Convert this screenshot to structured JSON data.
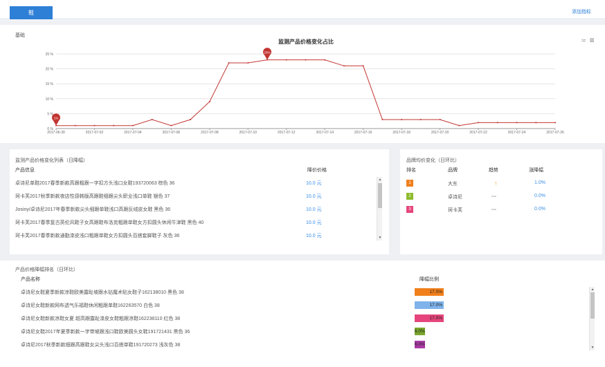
{
  "tab": {
    "label": "鞋"
  },
  "add_link": "添加指标",
  "chart_panel": {
    "label": "基础"
  },
  "chart_data": {
    "type": "line",
    "title": "监测产品价格变化占比",
    "x": [
      "2017-06-30",
      "2017-07-01",
      "2017-07-02",
      "2017-07-03",
      "2017-07-04",
      "2017-07-05",
      "2017-07-06",
      "2017-07-07",
      "2017-07-08",
      "2017-07-09",
      "2017-07-10",
      "2017-07-11",
      "2017-07-12",
      "2017-07-13",
      "2017-07-14",
      "2017-07-15",
      "2017-07-16",
      "2017-07-17",
      "2017-07-18",
      "2017-07-19",
      "2017-07-20",
      "2017-07-21",
      "2017-07-22",
      "2017-07-23",
      "2017-07-24",
      "2017-07-25",
      "2017-07-26"
    ],
    "xticks": [
      "2017-06-30",
      "2017-07-02",
      "2017-07-04",
      "2017-07-06",
      "2017-07-08",
      "2017-07-10",
      "2017-07-12",
      "2017-07-14",
      "2017-07-16",
      "2017-07-18",
      "2017-07-20",
      "2017-07-22",
      "2017-07-24",
      "2017-07-26"
    ],
    "values": [
      1,
      1,
      1,
      1,
      1,
      3,
      1,
      3,
      9,
      22,
      22,
      23,
      23,
      23,
      23,
      21,
      21,
      3,
      3,
      3,
      3,
      1,
      2,
      2,
      2,
      2,
      2
    ],
    "yticks": [
      "0 %",
      "5 %",
      "10 %",
      "15 %",
      "20 %",
      "25 %"
    ],
    "ylim": [
      0,
      25
    ],
    "markers": [
      {
        "index": 0,
        "label": "1%"
      },
      {
        "index": 11,
        "label": "23%"
      }
    ],
    "grid": true,
    "line_color": "#c23531"
  },
  "price_list": {
    "title": "监测产品价格变化列表（日降幅）",
    "col_product": "产品信息",
    "col_price": "降价价格",
    "rows": [
      {
        "name": "卓诗尼单鞋2017春季新款高跟粗跟一字扣方头浅口女鞋193720063 棕色 36",
        "price": "10.0 元"
      },
      {
        "name": "珂卡芙2017秋季新款夜店性感韩版高跟鞋细跟尖头职业浅口单鞋 银色 37",
        "price": "10.0 元"
      },
      {
        "name": "Josiny/卓诗尼2017年春季新款尖头细跟单鞋浅口高跟反绒皮女鞋 黑色 36",
        "price": "10.0 元"
      },
      {
        "name": "珂卡芙2017春季复古英伦风鞋子女高跟鞋布洛克粗跟单鞋女方扣圆头休闲牛津鞋 黑色 40",
        "price": "10.0 元"
      },
      {
        "name": "珂卡芙2017春季新款通勤漆皮浅口粗跟单鞋女方扣圆头百搭套脚鞋子 灰色 36",
        "price": "10.0 元"
      }
    ]
  },
  "brand_panel": {
    "title": "品牌均价变化（日环比）",
    "col_rank": "排名",
    "col_brand": "品牌",
    "col_trend": "趋势",
    "col_change": "涨降幅",
    "rows": [
      {
        "rank": "1",
        "brand": "大东",
        "trend": "↑",
        "change": "1.0%",
        "color": "#f07f1c"
      },
      {
        "rank": "2",
        "brand": "卓诗尼",
        "trend": "---",
        "change": "0.0%",
        "color": "#8dbb2c"
      },
      {
        "rank": "3",
        "brand": "珂卡芙",
        "trend": "---",
        "change": "0.0%",
        "color": "#e5457c"
      }
    ]
  },
  "drop_panel": {
    "title": "产品价格降幅排名（日环比）",
    "col_name": "产品名称",
    "col_ratio": "降幅比例",
    "rows": [
      {
        "name": "卓诗尼女鞋夏季新款凉鞋欧美露趾坡跟水钻魔术贴女鞋子162138010 黑色 38",
        "ratio": "17.0%",
        "value": 17,
        "color": "#f07f1c"
      },
      {
        "name": "卓诗尼女鞋新款网布透气乐福鞋休闲粗跟单鞋162263570 白色 38",
        "ratio": "17.0%",
        "value": 17,
        "color": "#7fb3ea"
      },
      {
        "name": "卓诗尼女鞋新款凉鞋女夏 超高跟露趾漆皮女鞋粗跟凉鞋162238110 红色 38",
        "ratio": "17.0%",
        "value": 17,
        "color": "#e5457c"
      },
      {
        "name": "卓诗尼女鞋2017年夏季新款一字带坡跟浅口鞋欧美圆头女鞋191721431 黑色 36",
        "ratio": "6.0%",
        "value": 6,
        "color": "#7aa72b"
      },
      {
        "name": "卓诗尼2017秋季新款细跟高跟鞋女尖头浅口百搭单鞋191720273 浅灰色 38",
        "ratio": "6.0%",
        "value": 6,
        "color": "#a93aa5"
      }
    ]
  }
}
